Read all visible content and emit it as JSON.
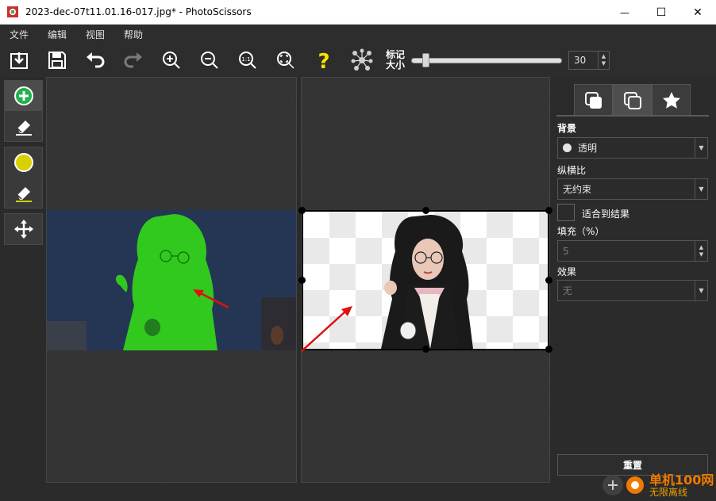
{
  "window": {
    "title": "2023-dec-07t11.01.16-017.jpg* - PhotoScissors",
    "minimize_glyph": "—",
    "maximize_glyph": "☐",
    "close_glyph": "✕"
  },
  "menu": [
    "文件",
    "编辑",
    "视图",
    "帮助"
  ],
  "toolbar": {
    "buttons": [
      "open-icon",
      "save-icon",
      "undo-icon",
      "redo-icon",
      "zoom-in-icon",
      "zoom-out-icon",
      "zoom-actual-icon",
      "zoom-fit-icon",
      "help-icon",
      "network-icon"
    ],
    "marker_label_line1": "标记",
    "marker_label_line2": "大小",
    "marker_size": "30",
    "marker_slider_fraction": 0.08
  },
  "left_tools": [
    "foreground-marker-icon",
    "foreground-eraser-icon",
    "background-marker-icon",
    "background-eraser-icon",
    "move-icon"
  ],
  "right_panel": {
    "tabs": [
      "background-tab-icon",
      "foreground-tab-icon",
      "effects-tab-icon"
    ],
    "background_label": "背景",
    "background_value": "透明",
    "aspect_label": "纵横比",
    "aspect_value": "无约束",
    "fit_result_label": "适合到结果",
    "fill_label": "填充（%）",
    "fill_value": "5",
    "effect_label": "效果",
    "effect_value": "无",
    "reset_label": "重置"
  },
  "watermark": {
    "line1": "单机100网",
    "line2": "无限离线"
  },
  "colors": {
    "foreground_marker": "#22b14c",
    "background_marker": "#d8d000",
    "help": "#f5e400",
    "arrow": "#e01010"
  }
}
